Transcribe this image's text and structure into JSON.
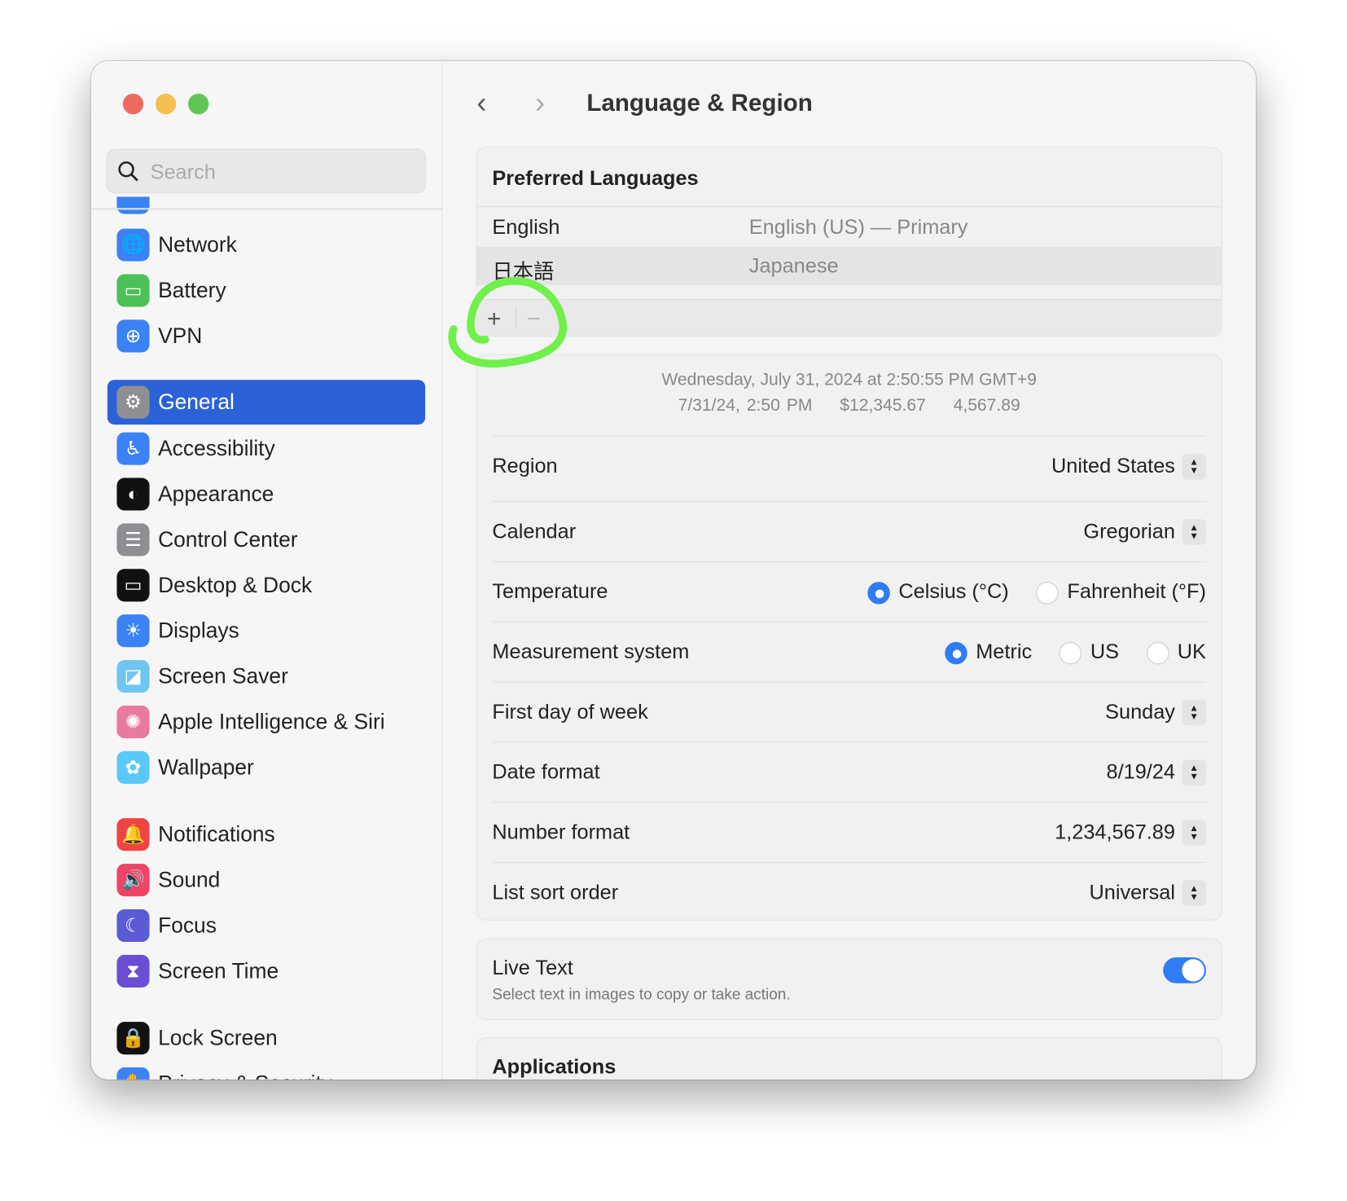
{
  "window": {
    "controls": [
      "close",
      "minimize",
      "zoom"
    ]
  },
  "sidebar": {
    "search_placeholder": "Search",
    "items": [
      {
        "label": "Network",
        "icon": "globe-icon",
        "color": "#3b82f6"
      },
      {
        "label": "Battery",
        "icon": "battery-icon",
        "color": "#4cc157"
      },
      {
        "label": "VPN",
        "icon": "vpn-globe-icon",
        "color": "#3b82f6"
      },
      {
        "label": "General",
        "icon": "gear-icon",
        "color": "#8e8e93",
        "selected": true
      },
      {
        "label": "Accessibility",
        "icon": "accessibility-icon",
        "color": "#3b82f6"
      },
      {
        "label": "Appearance",
        "icon": "appearance-icon",
        "color": "#111111"
      },
      {
        "label": "Control Center",
        "icon": "control-center-icon",
        "color": "#8e8e93"
      },
      {
        "label": "Desktop & Dock",
        "icon": "dock-icon",
        "color": "#111111"
      },
      {
        "label": "Displays",
        "icon": "sun-icon",
        "color": "#3b82f6"
      },
      {
        "label": "Screen Saver",
        "icon": "screen-saver-icon",
        "color": "#6ec6f0"
      },
      {
        "label": "Apple Intelligence & Siri",
        "icon": "siri-icon",
        "color": "#e879a0"
      },
      {
        "label": "Wallpaper",
        "icon": "flower-icon",
        "color": "#5ac8fa"
      },
      {
        "label": "Notifications",
        "icon": "bell-icon",
        "color": "#ef4444"
      },
      {
        "label": "Sound",
        "icon": "speaker-icon",
        "color": "#ef4465"
      },
      {
        "label": "Focus",
        "icon": "moon-icon",
        "color": "#5b5bd6"
      },
      {
        "label": "Screen Time",
        "icon": "hourglass-icon",
        "color": "#6a4fd6"
      },
      {
        "label": "Lock Screen",
        "icon": "lock-icon",
        "color": "#111111"
      },
      {
        "label": "Privacy & Security",
        "icon": "hand-icon",
        "color": "#3b82f6"
      }
    ]
  },
  "header": {
    "title": "Language & Region"
  },
  "languages": {
    "heading": "Preferred Languages",
    "rows": [
      {
        "name": "English",
        "detail": "English (US) — Primary"
      },
      {
        "name": "日本語",
        "detail": "Japanese",
        "selected": true
      }
    ],
    "add": "+",
    "remove": "−"
  },
  "sample": {
    "line1": "Wednesday, July 31, 2024 at 2:50:55 PM GMT+9",
    "line2": [
      "7/31/24, 2:50 PM",
      "$12,345.67",
      "4,567.89"
    ]
  },
  "settings": {
    "region": {
      "label": "Region",
      "value": "United States"
    },
    "calendar": {
      "label": "Calendar",
      "value": "Gregorian"
    },
    "temperature": {
      "label": "Temperature",
      "options": [
        "Celsius (°C)",
        "Fahrenheit (°F)"
      ],
      "selected": "Celsius (°C)"
    },
    "measurement": {
      "label": "Measurement system",
      "options": [
        "Metric",
        "US",
        "UK"
      ],
      "selected": "Metric"
    },
    "first_day": {
      "label": "First day of week",
      "value": "Sunday"
    },
    "date_format": {
      "label": "Date format",
      "value": "8/19/24"
    },
    "number_format": {
      "label": "Number format",
      "value": "1,234,567.89"
    },
    "sort_order": {
      "label": "List sort order",
      "value": "Universal"
    }
  },
  "live_text": {
    "label": "Live Text",
    "description": "Select text in images to copy or take action.",
    "enabled": true
  },
  "applications": {
    "heading": "Applications"
  },
  "annotation": {
    "color": "#6ff04a"
  },
  "accent": "#2c62d8"
}
